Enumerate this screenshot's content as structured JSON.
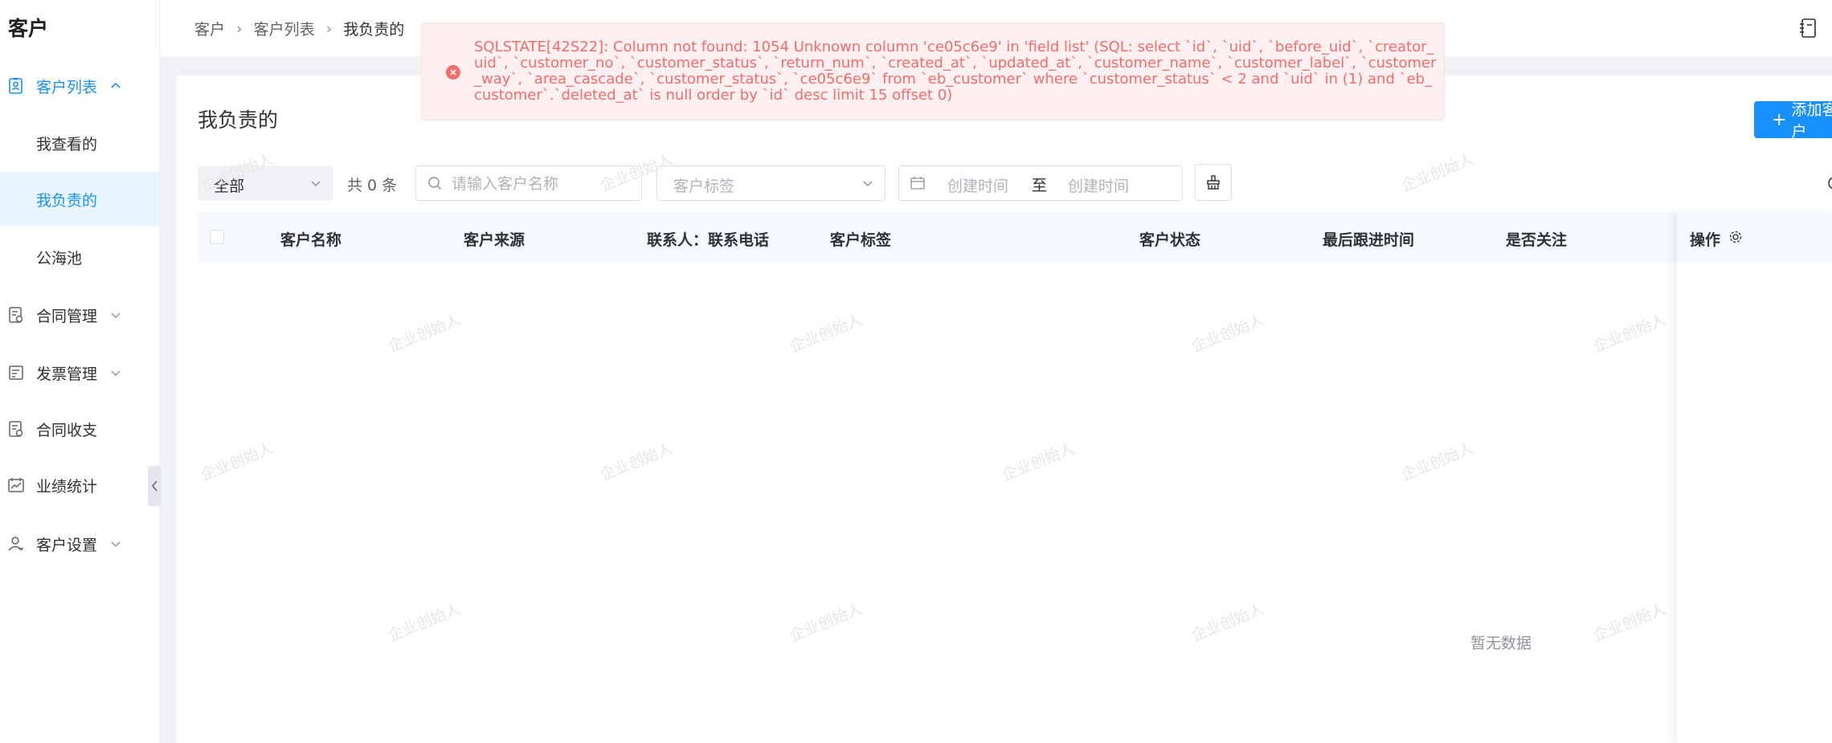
{
  "app": {
    "title": "客户"
  },
  "sidebar": {
    "parent_customer_list": "客户列表",
    "sub_items": [
      "我查看的",
      "我负责的",
      "公海池"
    ],
    "items": [
      "合同管理",
      "发票管理",
      "合同收支",
      "业绩统计",
      "客户设置"
    ]
  },
  "breadcrumb": [
    "客户",
    "客户列表",
    "我负责的"
  ],
  "page": {
    "title": "我负责的",
    "add_button": "添加客户"
  },
  "filters": {
    "scope_select": "全部",
    "total": "共 0 条",
    "search_placeholder": "请输入客户名称",
    "tag_placeholder": "客户标签",
    "date_start_placeholder": "创建时间",
    "date_separator": "至",
    "date_end_placeholder": "创建时间"
  },
  "table": {
    "columns": [
      "客户名称",
      "客户来源",
      "联系人：联系电话",
      "客户标签",
      "客户状态",
      "最后跟进时间",
      "是否关注"
    ],
    "action_column": "操作",
    "empty_text": "暂无数据"
  },
  "error_toast": {
    "message": "SQLSTATE[42S22]: Column not found: 1054 Unknown column 'ce05c6e9' in 'field list' (SQL: select `id`, `uid`, `before_uid`, `creator_uid`, `customer_no`, `customer_status`, `return_num`, `created_at`, `updated_at`, `customer_name`, `customer_label`, `customer_way`, `area_cascade`, `customer_status`, `ce05c6e9` from `eb_customer` where `customer_status` < 2 and `uid` in (1) and `eb_customer`.`deleted_at` is null order by `id` desc limit 15 offset 0)"
  },
  "watermark": "企业创始人",
  "colors": {
    "primary": "#1890ff",
    "error": "#f56c6c",
    "error_bg": "#fef0f0",
    "selected_bg": "#e8f4ff"
  }
}
